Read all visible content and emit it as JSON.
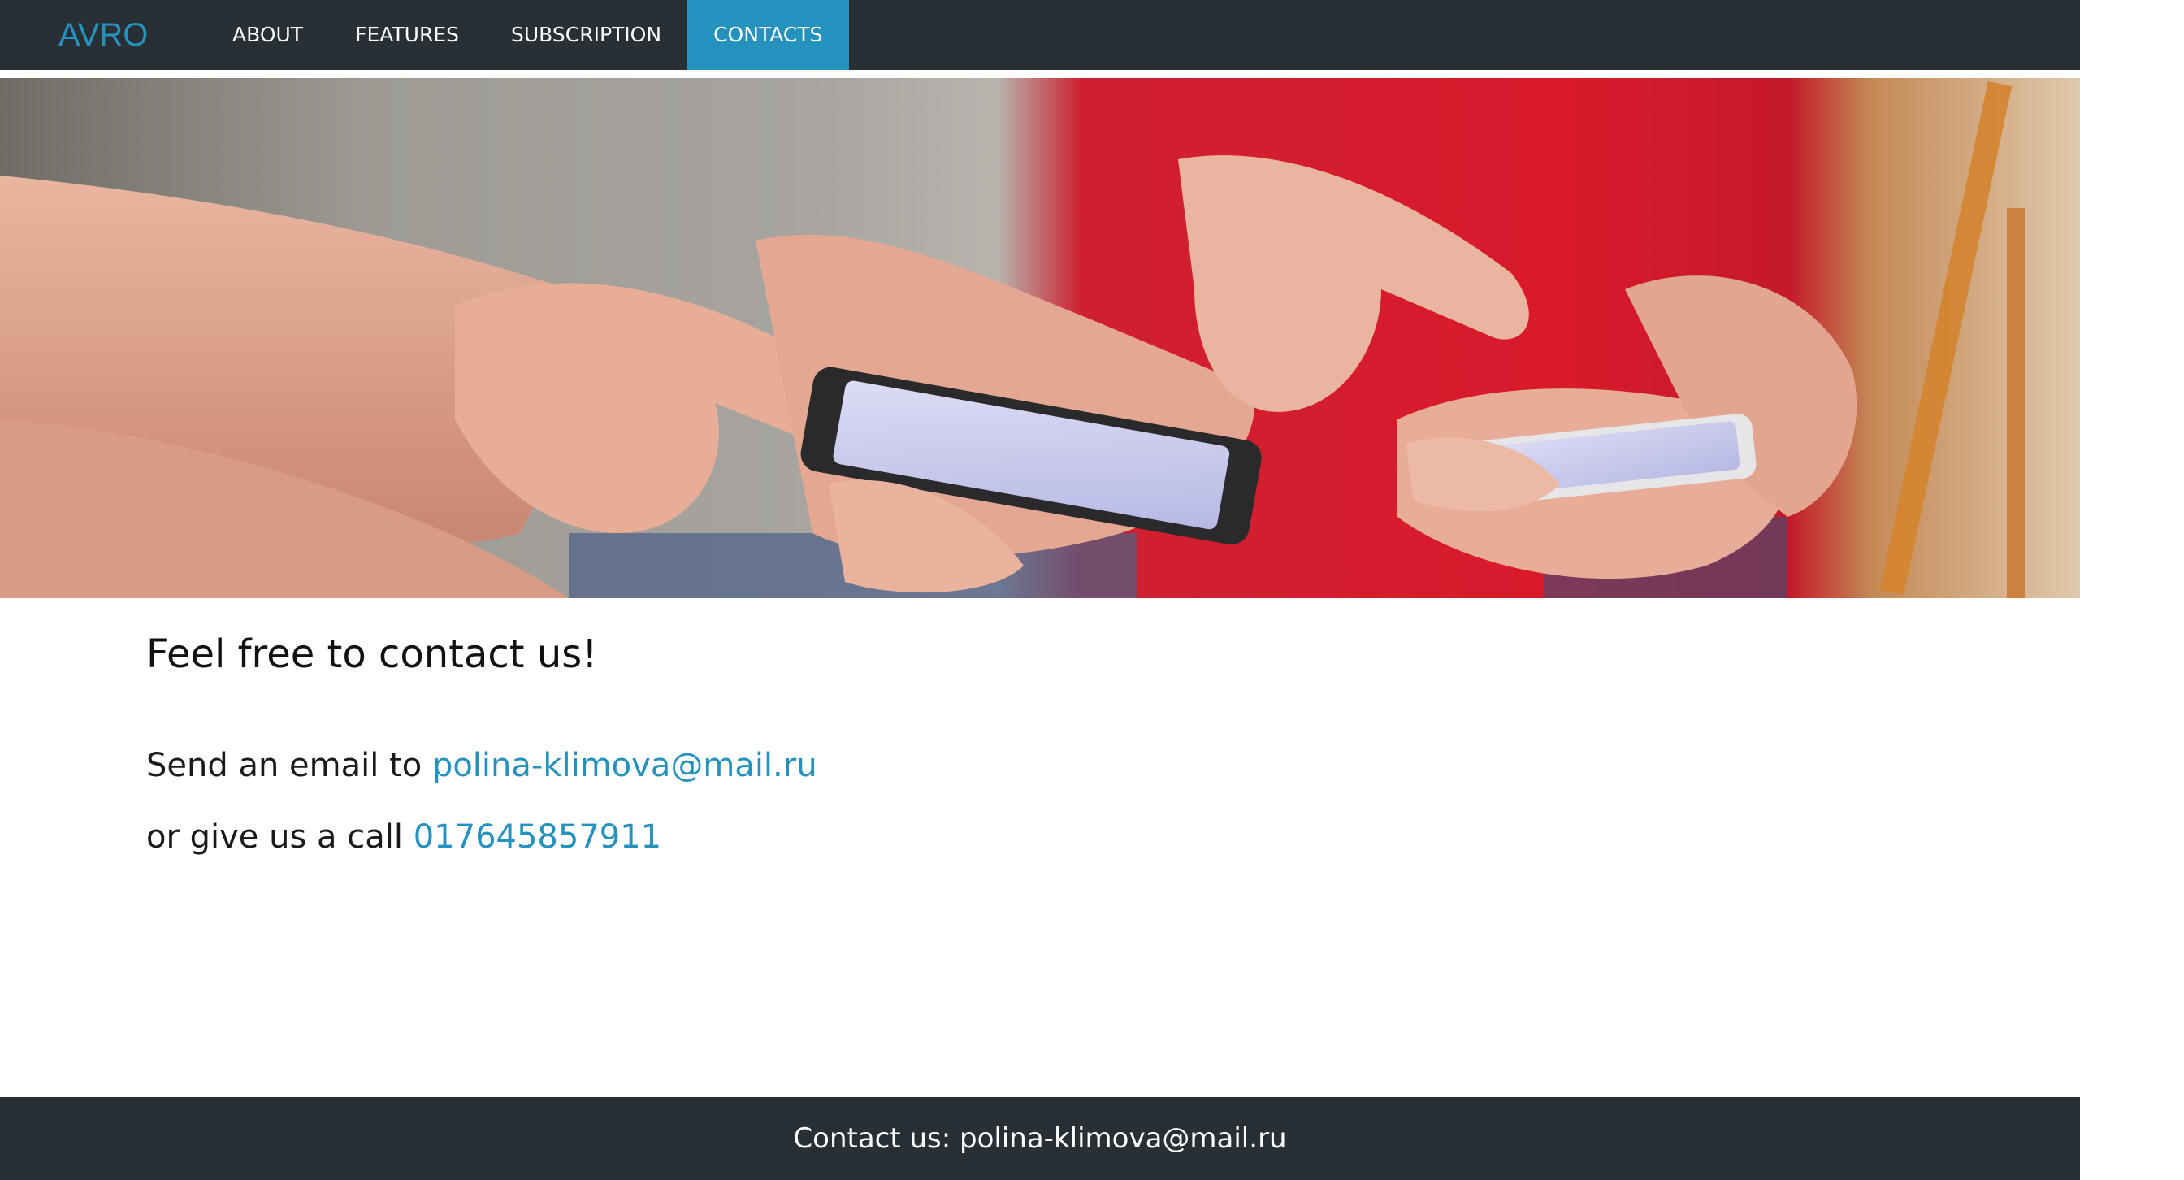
{
  "nav": {
    "brand": "AVRO",
    "links": [
      {
        "label": "ABOUT"
      },
      {
        "label": "FEATURES"
      },
      {
        "label": "SUBSCRIPTION"
      },
      {
        "label": "CONTACTS"
      }
    ],
    "active": "CONTACTS"
  },
  "hero": {
    "image": "hands-holding-smartphones-photo"
  },
  "contact": {
    "heading": "Feel free to contact us!",
    "email_prefix": "Send an email to ",
    "email": "polina-klimova@mail.ru",
    "phone_prefix": "or give us a call ",
    "phone": "017645857911"
  },
  "footer": {
    "text": "Contact us: polina-klimova@mail.ru"
  },
  "colors": {
    "nav_background": "#283035",
    "accent": "#2591bd",
    "text": "#111111",
    "background": "#ffffff"
  }
}
